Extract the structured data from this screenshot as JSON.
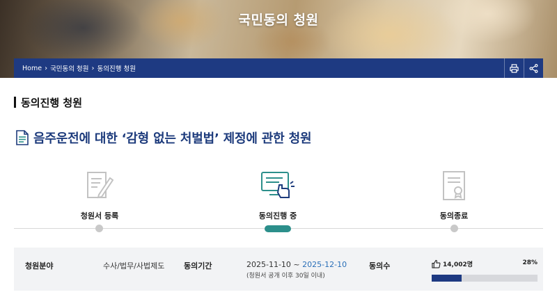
{
  "hero": {
    "title": "국민동의 청원"
  },
  "breadcrumb": {
    "items": [
      "Home",
      "국민동의 청원",
      "동의진행 청원"
    ],
    "separator": "›"
  },
  "tools": {
    "print_icon": "print-icon",
    "share_icon": "share-icon"
  },
  "section": {
    "heading": "동의진행 청원"
  },
  "petition": {
    "title": "음주운전에 대한 ‘감형 없는 처벌법’ 제정에 관한 청원",
    "icon": "document-icon"
  },
  "steps": [
    {
      "label": "청원서 등록",
      "icon": "edit-document-icon",
      "active": false
    },
    {
      "label": "동의진행 중",
      "icon": "computer-click-icon",
      "active": true
    },
    {
      "label": "동의종료",
      "icon": "certificate-icon",
      "active": false
    }
  ],
  "info": {
    "category_label": "청원분야",
    "category_value": "수사/법무/사법제도",
    "period_label": "동의기간",
    "period_start": "2025-11-10",
    "period_sep": " ~ ",
    "period_end": "2025-12-10",
    "period_note": "(청원서 공개 이후 30일 이내)",
    "count_label": "동의수",
    "count_value": "14,002명",
    "percent_label": "28%",
    "progress_fraction": 0.28
  },
  "colors": {
    "navy": "#1e3a82",
    "teal": "#2c8f8b",
    "link": "#2a6fb8"
  }
}
